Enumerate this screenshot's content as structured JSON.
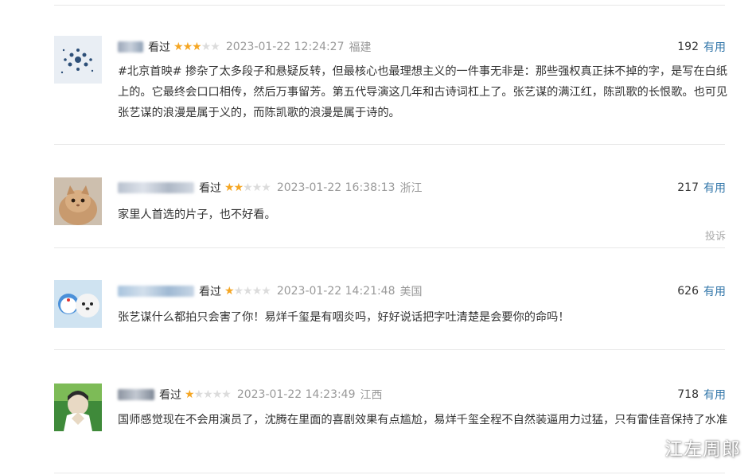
{
  "comments": [
    {
      "watched": "看过",
      "rating": 3,
      "time": "2023-01-22 12:24:27",
      "location": "福建",
      "votes": "192",
      "useful": "有用",
      "text": "#北京首映# 掺杂了太多段子和悬疑反转，但最核心也最理想主义的一件事无非是：那些强权真正抹不掉的字，是写在白纸上的。它最终会口口相传，然后万事留芳。第五代导演这几年和古诗词杠上了。张艺谋的满江红，陈凯歌的长恨歌。也可见张艺谋的浪漫是属于义的，而陈凯歌的浪漫是属于诗的。"
    },
    {
      "watched": "看过",
      "rating": 2,
      "time": "2023-01-22 16:38:13",
      "location": "浙江",
      "votes": "217",
      "useful": "有用",
      "text": "家里人首选的片子，也不好看。",
      "report": "投诉"
    },
    {
      "watched": "看过",
      "rating": 1,
      "time": "2023-01-22 14:21:48",
      "location": "美国",
      "votes": "626",
      "useful": "有用",
      "text": "张艺谋什么都拍只会害了你！易烊千玺是有咽炎吗，好好说话把字吐清楚是会要你的命吗！"
    },
    {
      "watched": "看过",
      "rating": 1,
      "time": "2023-01-22 14:23:49",
      "location": "江西",
      "votes": "718",
      "useful": "有用",
      "text": "国师感觉现在不会用演员了，沈腾在里面的喜剧效果有点尴尬，易烊千玺全程不自然装逼用力过猛，只有雷佳音保持了水准"
    }
  ],
  "watermark": "江左周郎",
  "colors": {
    "link": "#3377aa",
    "star": "#f5a623",
    "muted": "#999999"
  }
}
